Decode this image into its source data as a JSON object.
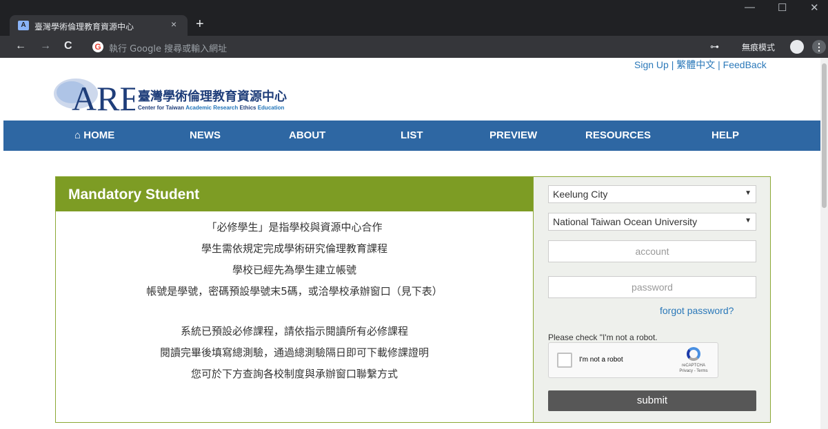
{
  "browser": {
    "tab_title": "臺灣學術倫理教育資源中心",
    "tab_close": "×",
    "new_tab": "+",
    "minimize": "—",
    "maximize": "☐",
    "close": "✕",
    "back": "←",
    "forward": "→",
    "reload": "C",
    "omnibox_placeholder": "執行 Google 搜尋或輸入網址",
    "incognito_label": "無痕模式",
    "menu": "⋮"
  },
  "top_links": {
    "signup": "Sign Up",
    "sep": " | ",
    "chinese": "繁體中文",
    "feedback": "FeedBack"
  },
  "logo": {
    "mark": "AREE",
    "name_zh": "臺灣學術倫理教育資源中心",
    "name_en_prefix": "Center for Taiwan ",
    "name_en_hl1": "Academic Research",
    "name_en_mid": " Ethics ",
    "name_en_hl2": "Education"
  },
  "nav": {
    "home": "HOME",
    "news": "NEWS",
    "about": "ABOUT",
    "list": "LIST",
    "preview": "PREVIEW",
    "resources": "RESOURCES",
    "help": "HELP"
  },
  "panel": {
    "title": "Mandatory Student",
    "lines": [
      "「必修學生」是指學校與資源中心合作",
      "學生需依規定完成學術研究倫理教育課程",
      "學校已經先為學生建立帳號",
      "帳號是學號，密碼預設學號末5碼，或洽學校承辦窗口（見下表）",
      "系統已預設必修課程，請依指示閱讀所有必修課程",
      "閱讀完畢後填寫總測驗，通過總測驗隔日即可下載修課證明",
      "您可於下方查詢各校制度與承辦窗口聯繫方式"
    ]
  },
  "login": {
    "city": "Keelung City",
    "school": "National Taiwan Ocean University",
    "account_placeholder": "account",
    "password_placeholder": "password",
    "forgot": "forgot password?",
    "robot_prompt": "Please check \"I'm not a robot.",
    "recaptcha_label": "I'm not a robot",
    "recaptcha_brand": "reCAPTCHA",
    "recaptcha_terms": "Privacy - Terms",
    "submit": "submit"
  },
  "colors": {
    "navbar": "#2e67a3",
    "panel_header": "#7d9c24",
    "link": "#2a78b9",
    "submit": "#575757"
  }
}
